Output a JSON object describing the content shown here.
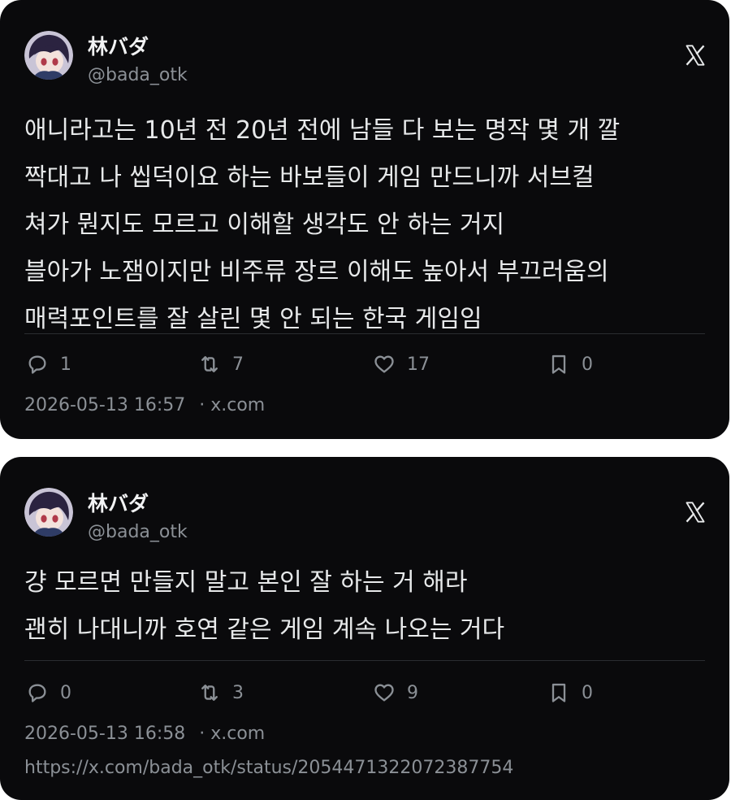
{
  "posts": [
    {
      "author_name": "林バダ",
      "author_handle": "@bada_otk",
      "lines": [
        "애니라고는 10년 전 20년 전에 남들 다 보는 명작 몇 개 깔",
        "짝대고 나 씹덕이요 하는 바보들이 게임 만드니까 서브컬",
        "쳐가 뭔지도 모르고 이해할 생각도 안 하는 거지",
        "블아가 노잼이지만 비주류 장르 이해도 높아서 부끄러움의",
        "매력포인트를 잘 살린 몇 안 되는 한국 게임임"
      ],
      "replies": "1",
      "reposts": "7",
      "likes": "17",
      "bookmarks": "0",
      "timestamp": "2026-05-13 16:57",
      "source": "· x.com"
    },
    {
      "author_name": "林バダ",
      "author_handle": "@bada_otk",
      "lines": [
        "걍 모르면 만들지 말고 본인 잘 하는 거 해라",
        "괜히 나대니까 호연 같은 게임 계속 나오는 거다"
      ],
      "replies": "0",
      "reposts": "3",
      "likes": "9",
      "bookmarks": "0",
      "timestamp": "2026-05-13 16:58",
      "source": "· x.com",
      "url": "https://x.com/bada_otk/status/2054471322072387754"
    }
  ],
  "icons": {
    "brand": "x-logo-icon",
    "reply": "reply-icon",
    "repost": "repost-icon",
    "like": "heart-icon",
    "bookmark": "bookmark-icon"
  },
  "colors": {
    "card_bg": "#0a0a0c",
    "text": "#e7e9ea",
    "muted": "#8b9096"
  }
}
